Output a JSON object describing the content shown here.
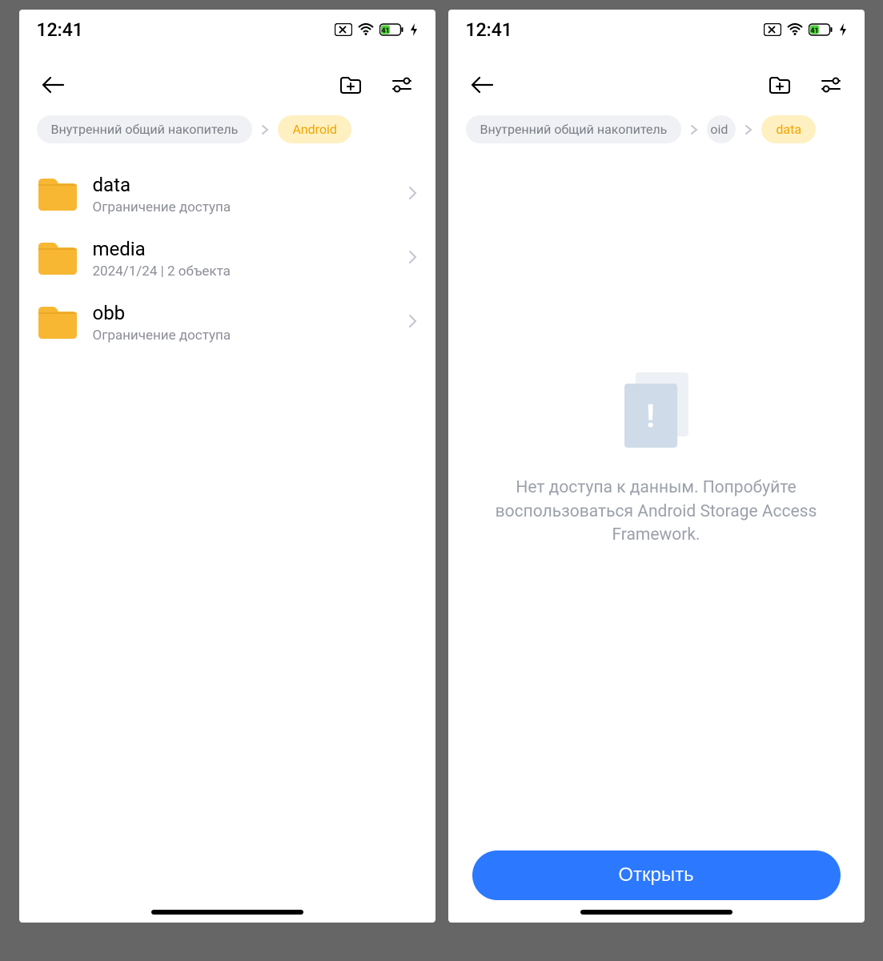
{
  "status": {
    "time": "12:41",
    "battery": "41"
  },
  "left_screen": {
    "breadcrumb": [
      {
        "label": "Внутренний общий накопитель",
        "active": false
      },
      {
        "label": "Android",
        "active": true
      }
    ],
    "folders": [
      {
        "name": "data",
        "sub": "Ограничение доступа"
      },
      {
        "name": "media",
        "sub": "2024/1/24  |  2 объекта"
      },
      {
        "name": "obb",
        "sub": "Ограничение доступа"
      }
    ]
  },
  "right_screen": {
    "breadcrumb": [
      {
        "label": "Внутренний общий накопитель",
        "active": false
      },
      {
        "label": "oid",
        "active": false
      },
      {
        "label": "data",
        "active": true
      }
    ],
    "empty_message": "Нет доступа к данным. Попробуйте воспользоваться Android Storage Access Framework.",
    "open_button": "Открыть"
  }
}
